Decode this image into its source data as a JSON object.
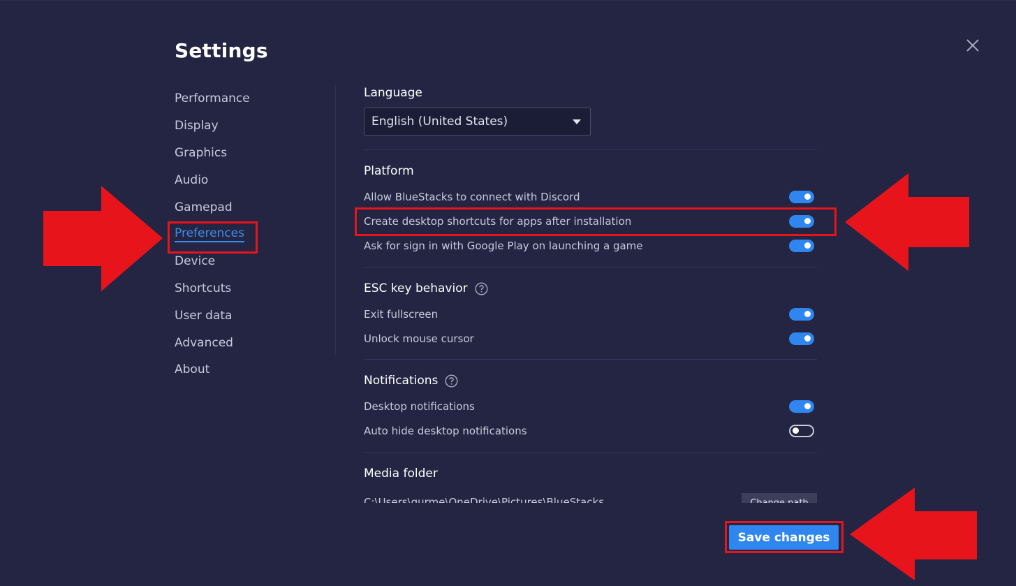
{
  "window": {
    "title": "Settings",
    "close_icon": "close-icon"
  },
  "sidebar": {
    "items": [
      {
        "label": "Performance",
        "active": false
      },
      {
        "label": "Display",
        "active": false
      },
      {
        "label": "Graphics",
        "active": false
      },
      {
        "label": "Audio",
        "active": false
      },
      {
        "label": "Gamepad",
        "active": false
      },
      {
        "label": "Preferences",
        "active": true
      },
      {
        "label": "Device",
        "active": false
      },
      {
        "label": "Shortcuts",
        "active": false
      },
      {
        "label": "User data",
        "active": false
      },
      {
        "label": "Advanced",
        "active": false
      },
      {
        "label": "About",
        "active": false
      }
    ]
  },
  "language": {
    "title": "Language",
    "selected": "English (United States)"
  },
  "platform": {
    "title": "Platform",
    "options": [
      {
        "label": "Allow BlueStacks to connect with Discord",
        "enabled": true
      },
      {
        "label": "Create desktop shortcuts for apps after installation",
        "enabled": true
      },
      {
        "label": "Ask for sign in with Google Play on launching a game",
        "enabled": true
      }
    ]
  },
  "esc": {
    "title": "ESC key behavior",
    "help_icon": "help-icon",
    "options": [
      {
        "label": "Exit fullscreen",
        "enabled": true
      },
      {
        "label": "Unlock mouse cursor",
        "enabled": true
      }
    ]
  },
  "notifications": {
    "title": "Notifications",
    "help_icon": "help-icon",
    "options": [
      {
        "label": "Desktop notifications",
        "enabled": true
      },
      {
        "label": "Auto hide desktop notifications",
        "enabled": false
      }
    ]
  },
  "media": {
    "title": "Media folder",
    "path": "C:\\Users\\gurme\\OneDrive\\Pictures\\BlueStacks",
    "change_label": "Change path"
  },
  "footer": {
    "save_label": "Save changes"
  },
  "colors": {
    "background": "#232543",
    "accent": "#2f86ee",
    "annotation": "#e8141c"
  }
}
